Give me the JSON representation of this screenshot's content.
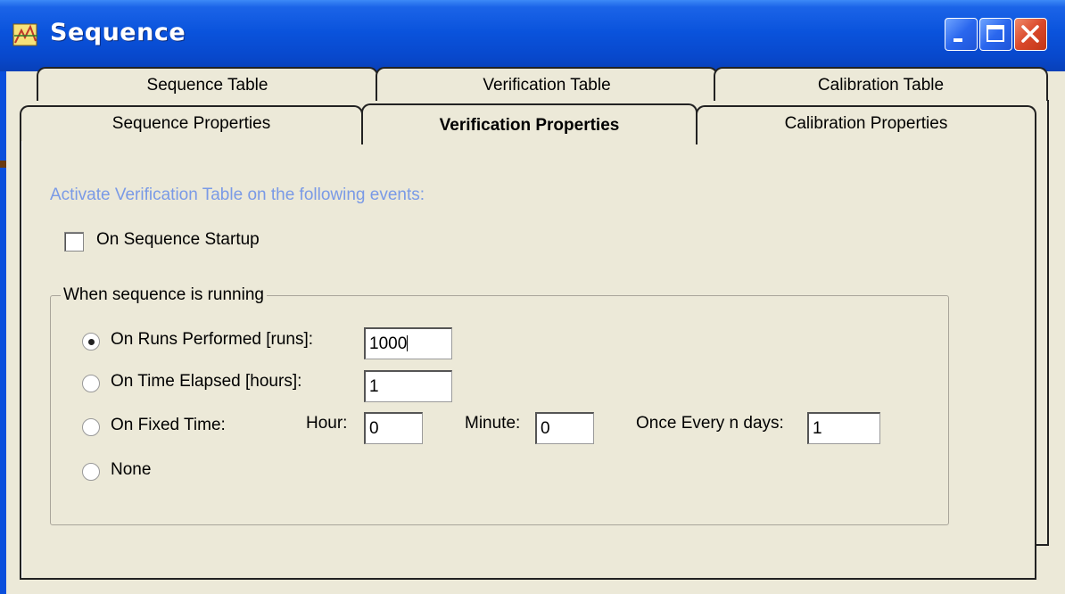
{
  "window": {
    "title": "Sequence",
    "icon": "sequence-app-icon",
    "buttons": [
      "minimize-icon",
      "maximize-icon",
      "close-icon"
    ]
  },
  "tabs": {
    "back_row": [
      "Sequence Table",
      "Verification Table",
      "Calibration Table"
    ],
    "front_row": [
      "Sequence Properties",
      "Verification Properties",
      "Calibration Properties"
    ],
    "active": "Verification Properties"
  },
  "content": {
    "heading": "Activate Verification Table on the following events:",
    "heading_color": "#7a9ae6",
    "startup_checkbox": {
      "label": "On Sequence Startup",
      "checked": false
    },
    "group": {
      "title": "When sequence is running",
      "options": [
        {
          "label": "On Runs Performed [runs]:",
          "checked": true,
          "value": "1000"
        },
        {
          "label": "On Time Elapsed [hours]:",
          "checked": false,
          "value": "1"
        },
        {
          "label": "On Fixed Time:",
          "checked": false,
          "hour_label": "Hour:",
          "hour_value": "0",
          "minute_label": "Minute:",
          "minute_value": "0",
          "days_label": "Once Every n days:",
          "days_value": "1"
        },
        {
          "label": "None",
          "checked": false
        }
      ]
    }
  }
}
